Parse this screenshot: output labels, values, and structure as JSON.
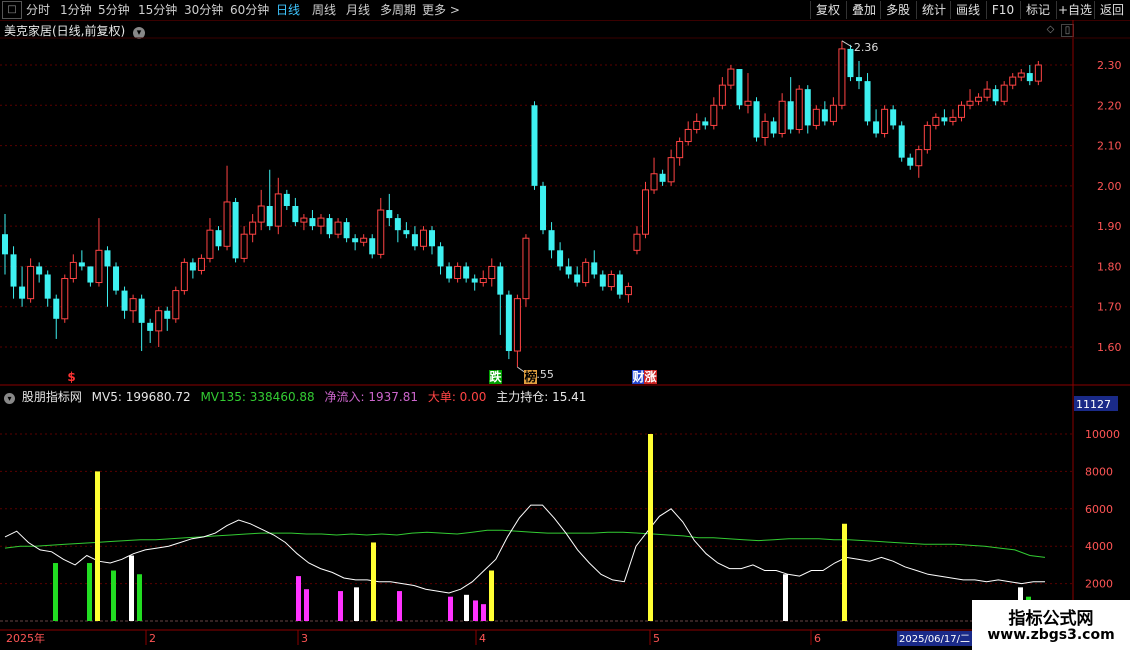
{
  "toolbar": {
    "periods": [
      "分时",
      "1分钟",
      "5分钟",
      "15分钟",
      "30分钟",
      "60分钟",
      "日线",
      "周线",
      "月线",
      "多周期",
      "更多 >"
    ],
    "active_period": "日线",
    "right_buttons": [
      "复权",
      "叠加",
      "多股",
      "统计",
      "画线",
      "F10",
      "标记",
      "+自选",
      "返回"
    ]
  },
  "main_chart": {
    "title": "美克家居(日线,前复权)",
    "price_axis": [
      "2.30",
      "2.20",
      "2.10",
      "2.00",
      "1.90",
      "1.80",
      "1.70",
      "1.60"
    ],
    "high_label": "2.36",
    "low_label": "1.55",
    "markers": [
      {
        "text": "$",
        "color": "#ff3333"
      },
      {
        "text": "跌",
        "color": "#ffffff",
        "bg": "#00a000"
      },
      {
        "text": "榜",
        "color": "#000000",
        "bg": "#e0a040"
      },
      {
        "text": "财",
        "color": "#ffffff",
        "bg": "#2244cc"
      },
      {
        "text": "涨",
        "color": "#ffffff",
        "bg": "#cc2222"
      }
    ]
  },
  "indicator": {
    "name": "股朋指标网",
    "mv5_label": "MV5: 199680.72",
    "mv135_label": "MV135: 338460.88",
    "inflow_label": "净流入: 1937.81",
    "big_order_label": "大单: 0.00",
    "holding_label": "主力持仓: 15.41",
    "current_value": "11127",
    "axis": [
      "10000",
      "8000",
      "6000",
      "4000",
      "2000"
    ]
  },
  "date_axis": {
    "year_label": "2025年",
    "months": [
      "2",
      "3",
      "4",
      "5",
      "6"
    ],
    "current_date": "2025/06/17/二"
  },
  "watermark": {
    "line1": "指标公式网",
    "line2": "www.zbgs3.com"
  },
  "colors": {
    "up": "#ff4444",
    "down": "#3ef0f0",
    "ma_white": "#ffffff",
    "ma_green": "#33cc33",
    "grid": "#5a0000"
  },
  "chart_data": {
    "type": "candlestick",
    "title": "美克家居(日线,前复权)",
    "ylim": [
      1.55,
      2.36
    ],
    "candles": [
      [
        1.88,
        1.83,
        1.93,
        1.78
      ],
      [
        1.83,
        1.75,
        1.85,
        1.72
      ],
      [
        1.75,
        1.72,
        1.8,
        1.7
      ],
      [
        1.72,
        1.8,
        1.82,
        1.71
      ],
      [
        1.8,
        1.78,
        1.81,
        1.76
      ],
      [
        1.78,
        1.72,
        1.79,
        1.7
      ],
      [
        1.72,
        1.67,
        1.73,
        1.62
      ],
      [
        1.67,
        1.77,
        1.78,
        1.66
      ],
      [
        1.77,
        1.81,
        1.83,
        1.76
      ],
      [
        1.81,
        1.8,
        1.84,
        1.79
      ],
      [
        1.8,
        1.76,
        1.8,
        1.75
      ],
      [
        1.76,
        1.84,
        1.92,
        1.75
      ],
      [
        1.84,
        1.8,
        1.85,
        1.7
      ],
      [
        1.8,
        1.74,
        1.81,
        1.73
      ],
      [
        1.74,
        1.69,
        1.75,
        1.67
      ],
      [
        1.69,
        1.72,
        1.73,
        1.66
      ],
      [
        1.72,
        1.66,
        1.73,
        1.59
      ],
      [
        1.66,
        1.64,
        1.67,
        1.61
      ],
      [
        1.64,
        1.69,
        1.7,
        1.6
      ],
      [
        1.69,
        1.67,
        1.7,
        1.64
      ],
      [
        1.67,
        1.74,
        1.75,
        1.66
      ],
      [
        1.74,
        1.81,
        1.82,
        1.73
      ],
      [
        1.81,
        1.79,
        1.82,
        1.77
      ],
      [
        1.79,
        1.82,
        1.83,
        1.78
      ],
      [
        1.82,
        1.89,
        1.92,
        1.81
      ],
      [
        1.89,
        1.85,
        1.9,
        1.84
      ],
      [
        1.85,
        1.96,
        2.05,
        1.84
      ],
      [
        1.96,
        1.82,
        1.97,
        1.81
      ],
      [
        1.82,
        1.88,
        1.9,
        1.81
      ],
      [
        1.88,
        1.91,
        1.93,
        1.86
      ],
      [
        1.91,
        1.95,
        1.99,
        1.89
      ],
      [
        1.95,
        1.9,
        2.04,
        1.89
      ],
      [
        1.9,
        1.98,
        2.02,
        1.88
      ],
      [
        1.98,
        1.95,
        1.99,
        1.94
      ],
      [
        1.95,
        1.91,
        1.97,
        1.9
      ],
      [
        1.91,
        1.92,
        1.93,
        1.89
      ],
      [
        1.92,
        1.9,
        1.94,
        1.89
      ],
      [
        1.9,
        1.92,
        1.93,
        1.88
      ],
      [
        1.92,
        1.88,
        1.93,
        1.87
      ],
      [
        1.88,
        1.91,
        1.92,
        1.87
      ],
      [
        1.91,
        1.87,
        1.92,
        1.86
      ],
      [
        1.87,
        1.86,
        1.88,
        1.84
      ],
      [
        1.86,
        1.87,
        1.88,
        1.85
      ],
      [
        1.87,
        1.83,
        1.88,
        1.82
      ],
      [
        1.83,
        1.94,
        1.97,
        1.82
      ],
      [
        1.94,
        1.92,
        1.98,
        1.9
      ],
      [
        1.92,
        1.89,
        1.93,
        1.86
      ],
      [
        1.89,
        1.88,
        1.91,
        1.87
      ],
      [
        1.88,
        1.85,
        1.9,
        1.84
      ],
      [
        1.85,
        1.89,
        1.9,
        1.84
      ],
      [
        1.89,
        1.85,
        1.9,
        1.83
      ],
      [
        1.85,
        1.8,
        1.86,
        1.78
      ],
      [
        1.8,
        1.77,
        1.81,
        1.76
      ],
      [
        1.77,
        1.8,
        1.81,
        1.76
      ],
      [
        1.8,
        1.77,
        1.81,
        1.76
      ],
      [
        1.77,
        1.76,
        1.78,
        1.74
      ],
      [
        1.76,
        1.77,
        1.79,
        1.75
      ],
      [
        1.77,
        1.8,
        1.82,
        1.75
      ],
      [
        1.8,
        1.73,
        1.81,
        1.63
      ],
      [
        1.73,
        1.59,
        1.74,
        1.57
      ],
      [
        1.59,
        1.72,
        1.73,
        1.55
      ],
      [
        1.72,
        1.87,
        1.88,
        1.7
      ],
      [
        2.2,
        2.0,
        2.21,
        1.99
      ],
      [
        2.0,
        1.89,
        2.01,
        1.88
      ],
      [
        1.89,
        1.84,
        1.91,
        1.82
      ],
      [
        1.84,
        1.8,
        1.86,
        1.79
      ],
      [
        1.8,
        1.78,
        1.82,
        1.77
      ],
      [
        1.78,
        1.76,
        1.8,
        1.75
      ],
      [
        1.76,
        1.81,
        1.82,
        1.75
      ],
      [
        1.81,
        1.78,
        1.84,
        1.77
      ],
      [
        1.78,
        1.75,
        1.79,
        1.74
      ],
      [
        1.75,
        1.78,
        1.79,
        1.74
      ],
      [
        1.78,
        1.73,
        1.79,
        1.72
      ],
      [
        1.73,
        1.75,
        1.76,
        1.71
      ],
      [
        1.84,
        1.88,
        1.9,
        1.83
      ],
      [
        1.88,
        1.99,
        2.01,
        1.87
      ],
      [
        1.99,
        2.03,
        2.07,
        1.98
      ],
      [
        2.03,
        2.01,
        2.04,
        2.0
      ],
      [
        2.01,
        2.07,
        2.09,
        2.0
      ],
      [
        2.07,
        2.11,
        2.12,
        2.05
      ],
      [
        2.11,
        2.14,
        2.16,
        2.1
      ],
      [
        2.14,
        2.16,
        2.18,
        2.13
      ],
      [
        2.16,
        2.15,
        2.17,
        2.14
      ],
      [
        2.15,
        2.2,
        2.22,
        2.14
      ],
      [
        2.2,
        2.25,
        2.27,
        2.19
      ],
      [
        2.25,
        2.29,
        2.3,
        2.24
      ],
      [
        2.29,
        2.2,
        2.29,
        2.19
      ],
      [
        2.2,
        2.21,
        2.28,
        2.18
      ],
      [
        2.21,
        2.12,
        2.22,
        2.11
      ],
      [
        2.12,
        2.16,
        2.18,
        2.1
      ],
      [
        2.16,
        2.13,
        2.17,
        2.12
      ],
      [
        2.13,
        2.21,
        2.23,
        2.12
      ],
      [
        2.21,
        2.14,
        2.27,
        2.13
      ],
      [
        2.14,
        2.24,
        2.25,
        2.13
      ],
      [
        2.24,
        2.15,
        2.25,
        2.13
      ],
      [
        2.15,
        2.19,
        2.2,
        2.14
      ],
      [
        2.19,
        2.16,
        2.21,
        2.15
      ],
      [
        2.16,
        2.2,
        2.22,
        2.15
      ],
      [
        2.2,
        2.34,
        2.36,
        2.19
      ],
      [
        2.34,
        2.27,
        2.35,
        2.26
      ],
      [
        2.27,
        2.26,
        2.31,
        2.24
      ],
      [
        2.26,
        2.16,
        2.28,
        2.15
      ],
      [
        2.16,
        2.13,
        2.19,
        2.12
      ],
      [
        2.13,
        2.19,
        2.2,
        2.12
      ],
      [
        2.19,
        2.15,
        2.2,
        2.14
      ],
      [
        2.15,
        2.07,
        2.16,
        2.06
      ],
      [
        2.07,
        2.05,
        2.08,
        2.04
      ],
      [
        2.05,
        2.09,
        2.1,
        2.02
      ],
      [
        2.09,
        2.15,
        2.16,
        2.08
      ],
      [
        2.15,
        2.17,
        2.18,
        2.14
      ],
      [
        2.17,
        2.16,
        2.19,
        2.15
      ],
      [
        2.16,
        2.17,
        2.19,
        2.15
      ],
      [
        2.17,
        2.2,
        2.21,
        2.16
      ],
      [
        2.2,
        2.21,
        2.24,
        2.19
      ],
      [
        2.21,
        2.22,
        2.23,
        2.2
      ],
      [
        2.22,
        2.24,
        2.26,
        2.21
      ],
      [
        2.24,
        2.21,
        2.25,
        2.2
      ],
      [
        2.21,
        2.25,
        2.26,
        2.2
      ],
      [
        2.25,
        2.27,
        2.28,
        2.24
      ],
      [
        2.27,
        2.28,
        2.29,
        2.26
      ],
      [
        2.28,
        2.26,
        2.3,
        2.25
      ],
      [
        2.26,
        2.3,
        2.31,
        2.25
      ]
    ],
    "indicator": {
      "ylim": [
        0,
        11127
      ],
      "mv_white": [
        4500,
        4800,
        4200,
        3800,
        3700,
        3300,
        3000,
        3500,
        3200,
        3100,
        3300,
        3600,
        3800,
        3900,
        4000,
        4200,
        4400,
        4500,
        4700,
        5100,
        5400,
        5200,
        4900,
        4600,
        4200,
        3600,
        3100,
        2800,
        2600,
        2300,
        2200,
        2200,
        2100,
        2100,
        2000,
        1900,
        1700,
        1600,
        1500,
        1700,
        2100,
        2700,
        3300,
        4500,
        5500,
        6200,
        6200,
        5500,
        4700,
        3800,
        3100,
        2500,
        2200,
        2100,
        4000,
        4800,
        5600,
        6000,
        5300,
        4300,
        3600,
        3100,
        2800,
        2800,
        3000,
        2700,
        2700,
        2500,
        2400,
        2700,
        2700,
        3100,
        3400,
        3300,
        3200,
        3400,
        3200,
        2900,
        2700,
        2500,
        2400,
        2300,
        2200,
        2200,
        2100,
        2200,
        2100,
        2000,
        2100,
        2100
      ],
      "mv_green": [
        3900,
        4000,
        4000,
        4050,
        4100,
        4150,
        4200,
        4250,
        4300,
        4350,
        4350,
        4400,
        4450,
        4500,
        4550,
        4600,
        4650,
        4700,
        4700,
        4700,
        4650,
        4650,
        4600,
        4650,
        4600,
        4650,
        4600,
        4700,
        4750,
        4700,
        4650,
        4750,
        4850,
        4850,
        4800,
        4750,
        4700,
        4700,
        4700,
        4700,
        4750,
        4750,
        4700,
        4650,
        4600,
        4550,
        4450,
        4450,
        4400,
        4350,
        4300,
        4350,
        4400,
        4400,
        4400,
        4350,
        4350,
        4300,
        4250,
        4200,
        4150,
        4100,
        4100,
        4100,
        4050,
        4000,
        3900,
        3800,
        3500,
        3400
      ],
      "bars": [
        {
          "v": 3100,
          "color": "#22dd22"
        },
        {
          "v": 3100,
          "color": "#22dd22"
        },
        {
          "v": 8000,
          "color": "#ffff33"
        },
        {
          "v": 3500,
          "color": "#ffffff"
        },
        {
          "v": 2700,
          "color": "#22dd22"
        },
        {
          "v": 2500,
          "color": "#22dd22"
        },
        {
          "v": 2400,
          "color": "#ff33ff"
        },
        {
          "v": 1700,
          "color": "#ff33ff"
        },
        {
          "v": 1600,
          "color": "#ff33ff"
        },
        {
          "v": 1800,
          "color": "#ffffff"
        },
        {
          "v": 4200,
          "color": "#ffff33"
        },
        {
          "v": 1600,
          "color": "#ff33ff"
        },
        {
          "v": 1300,
          "color": "#ff33ff"
        },
        {
          "v": 1400,
          "color": "#ffffff"
        },
        {
          "v": 1100,
          "color": "#ff33ff"
        },
        {
          "v": 900,
          "color": "#ff33ff"
        },
        {
          "v": 2700,
          "color": "#ffff33"
        },
        {
          "v": 10000,
          "color": "#ffff33"
        },
        {
          "v": 2500,
          "color": "#ffffff"
        },
        {
          "v": 5200,
          "color": "#ffff33"
        },
        {
          "v": 1800,
          "color": "#ffffff"
        },
        {
          "v": 1300,
          "color": "#22dd22"
        }
      ]
    }
  }
}
